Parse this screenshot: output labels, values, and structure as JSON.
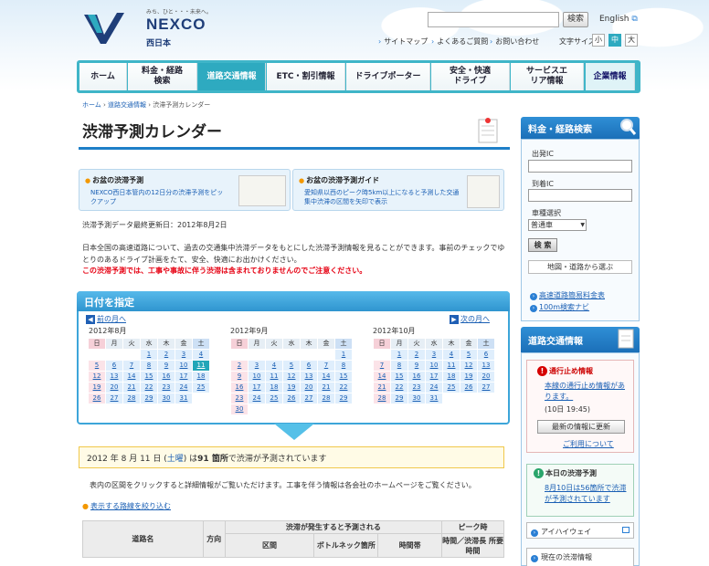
{
  "header": {
    "logo_tagline": "みち、ひと・・・未来へ。",
    "logo_name": "NEXCO",
    "logo_sub": "西日本",
    "search_button": "検索",
    "language": "English",
    "util_links": [
      "サイトマップ",
      "よくあるご質問",
      "お問い合わせ"
    ],
    "fontsize_label": "文字サイズ",
    "fontsize_options": [
      "小",
      "中",
      "大"
    ]
  },
  "nav": {
    "items": [
      {
        "label": "ホーム"
      },
      {
        "label": "料金・経路検索"
      },
      {
        "label": "道路交通情報"
      },
      {
        "label": "ETC・割引情報"
      },
      {
        "label": "ドライブポーター"
      },
      {
        "label": "安全・快適ドライブ"
      },
      {
        "label": "サービスエリア情報"
      },
      {
        "label": "企業情報"
      }
    ]
  },
  "breadcrumb": [
    "ホーム",
    "道路交通情報",
    "渋滞予測カレンダー"
  ],
  "page_title": "渋滞予測カレンダー",
  "banners": [
    {
      "title": "お盆の渋滞予測",
      "desc": "NEXCO西日本管内の12日分の渋滞予測をピックアップ"
    },
    {
      "title": "お盆の渋滞予測ガイド",
      "desc": "愛知県以西のピーク時5km以上になると予測した交通集中渋滞の区間を矢印で表示"
    }
  ],
  "updated": "渋滞予測データ最終更新日：2012年8月2日",
  "description": "日本全国の高速道路について、過去の交通集中渋滞データをもとにした渋滞予測情報を見ることができます。事前のチェックでゆとりのあるドライブ計画をたて、安全、快適にお出かけください。",
  "warning": "この渋滞予測では、工事や事故に伴う渋滞は含まれておりませんのでご注意ください。",
  "calendar": {
    "heading": "日付を指定",
    "prev": "前の月へ",
    "next": "次の月へ",
    "weekdays": [
      "日",
      "月",
      "火",
      "水",
      "木",
      "金",
      "土"
    ],
    "months": [
      {
        "label": "2012年8月",
        "offset": 3,
        "days": 31
      },
      {
        "label": "2012年9月",
        "offset": 6,
        "days": 30
      },
      {
        "label": "2012年10月",
        "offset": 1,
        "days": 31
      }
    ],
    "selected": {
      "month": 0,
      "day": 11
    }
  },
  "result": {
    "prefix": "2012 年 8 月 11 日 (",
    "weekday": "土曜",
    "middle": ") は",
    "count": "91 箇所",
    "suffix": "で渋滞が予測されています"
  },
  "hint": "表内の区間をクリックすると詳細情報がご覧いただけます。工事を伴う情報は各会社のホームページをご覧ください。",
  "filter_link": "表示する路線を絞り込む",
  "table": {
    "col_road": "道路名",
    "col_dir": "方向",
    "col_group": "渋滞が発生すると予測される",
    "col_section": "区間",
    "col_bottleneck": "ボトルネック箇所",
    "col_time": "時間帯",
    "col_peak": "ピーク時",
    "col_peak_sub": "時間／渋滞長 所要時間"
  },
  "sidebar": {
    "route_head": "料金・経路検索",
    "from_label": "出発IC",
    "to_label": "到着IC",
    "car_label": "車種選択",
    "car_value": "普通車",
    "search_btn": "検 索",
    "map_btn": "地図・道路から選ぶ",
    "links": [
      "高速道路簡易料金表",
      "100m検索ナビ"
    ],
    "traffic_head": "道路交通情報",
    "closure_title": "通行止め情報",
    "closure_link": "本線の通行止め情報があります。",
    "closure_time": "(10日 19:45)",
    "closure_btn": "最新の情報に更新",
    "usage": "ご利用について",
    "today_title": "本日の渋滞予測",
    "today_link": "8月10日は56箇所で渋滞が予測されています",
    "highway": "アイハイウェイ",
    "current": "現在の渋滞情報"
  }
}
